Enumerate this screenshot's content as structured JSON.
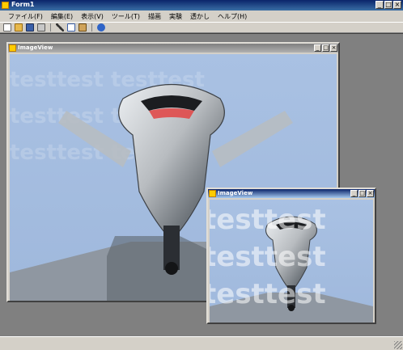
{
  "app": {
    "title": "Form1",
    "min": "_",
    "max": "□",
    "close": "×"
  },
  "menu": [
    "ファイル(F)",
    "編集(E)",
    "表示(V)",
    "ツール(T)",
    "描画",
    "実験",
    "透かし",
    "ヘルプ(H)"
  ],
  "toolbar": {
    "icons": [
      "new-icon",
      "open-icon",
      "save-icon",
      "print-icon",
      "cut-icon",
      "copy-icon",
      "paste-icon",
      "help-icon"
    ]
  },
  "windows": [
    {
      "title": "ImageView",
      "active": false,
      "min": "_",
      "max": "□",
      "close": "×"
    },
    {
      "title": "ImageView",
      "active": true,
      "min": "_",
      "max": "□",
      "close": "×"
    }
  ],
  "watermark": {
    "text": "testtest"
  }
}
